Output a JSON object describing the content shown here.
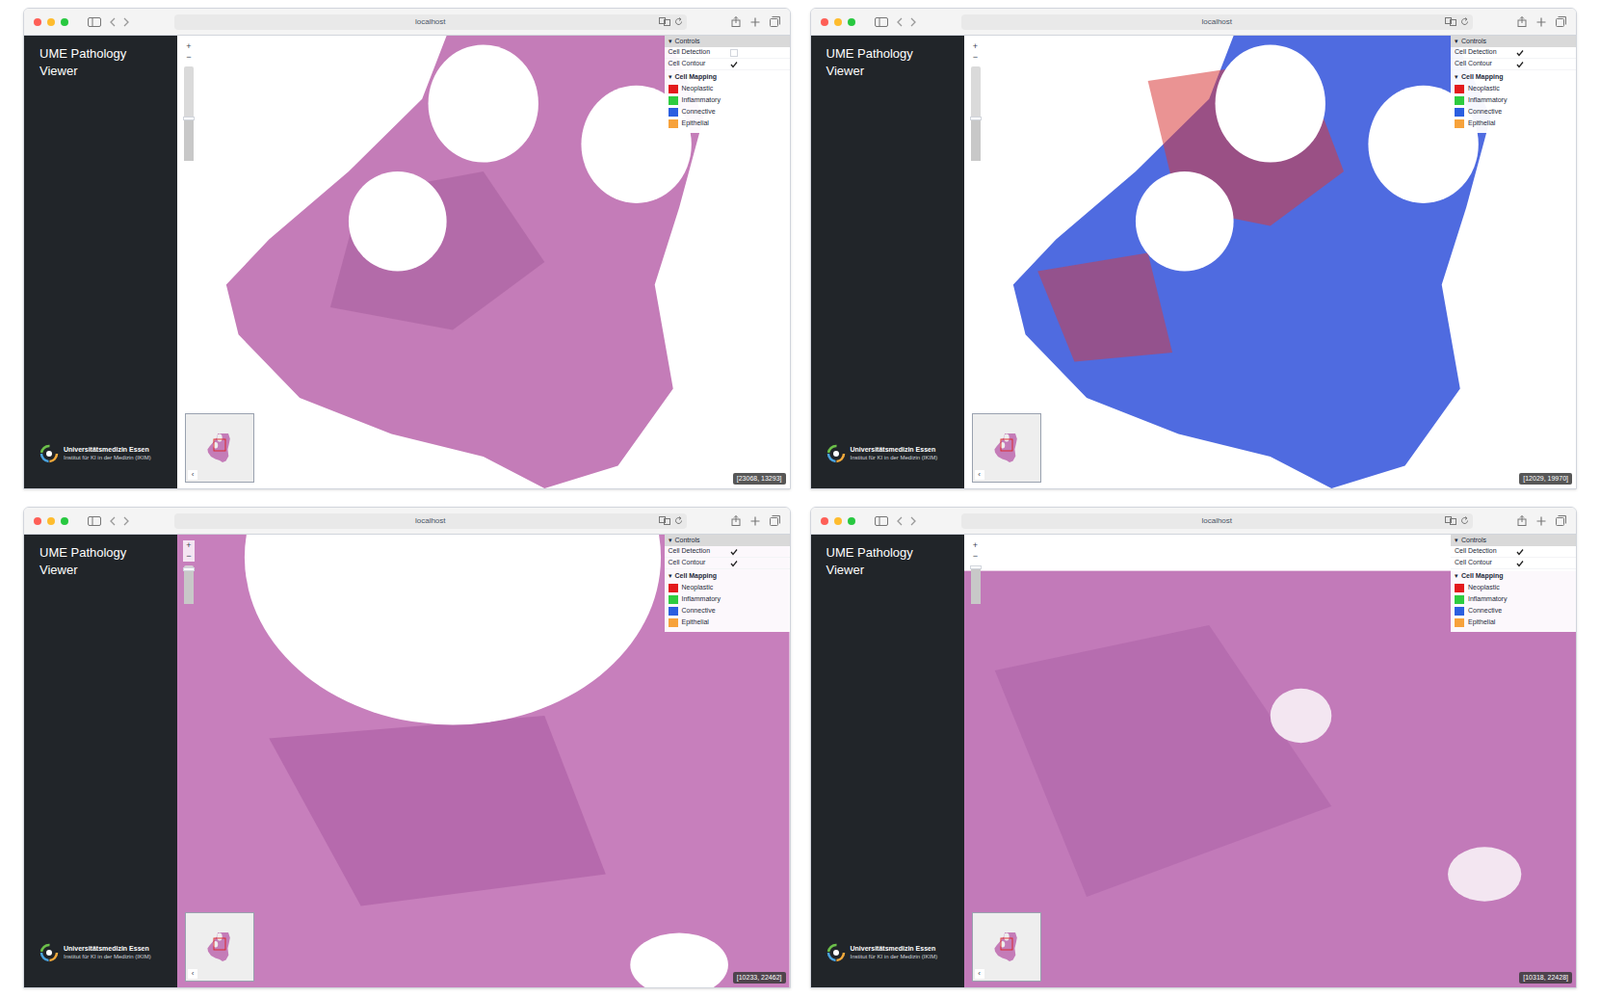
{
  "panels": [
    {
      "kind": "overview",
      "url": "localhost",
      "app_title": "UME Pathology Viewer",
      "zoom": {
        "in": "+",
        "out": "−"
      },
      "slider": {
        "level": 0.45
      },
      "controls": {
        "caret": "▾",
        "title": "Controls",
        "toggles": [
          {
            "label": "Cell Detection",
            "checked": false
          },
          {
            "label": "Cell Contour",
            "checked": true
          }
        ]
      },
      "legend": {
        "caret": "▾",
        "title": "Cell Mapping",
        "items": [
          {
            "label": "Neoplastic",
            "color": "#e31a1c"
          },
          {
            "label": "Inflammatory",
            "color": "#2ecc40"
          },
          {
            "label": "Connective",
            "color": "#2b5fe0"
          },
          {
            "label": "Epithelial",
            "color": "#f7a23b"
          }
        ]
      },
      "minimap_button": "‹",
      "coordinates": "[23068, 13293]",
      "footer": {
        "org": "Universitätsmedizin Essen",
        "institute": "Institut für KI in der Medizin (IKIM)"
      }
    },
    {
      "kind": "overlay",
      "url": "localhost",
      "app_title": "UME Pathology Viewer",
      "zoom": {
        "in": "+",
        "out": "−"
      },
      "slider": {
        "level": 0.45
      },
      "controls": {
        "caret": "▾",
        "title": "Controls",
        "toggles": [
          {
            "label": "Cell Detection",
            "checked": true
          },
          {
            "label": "Cell Contour",
            "checked": true
          }
        ]
      },
      "legend": {
        "caret": "▾",
        "title": "Cell Mapping",
        "items": [
          {
            "label": "Neoplastic",
            "color": "#e31a1c"
          },
          {
            "label": "Inflammatory",
            "color": "#2ecc40"
          },
          {
            "label": "Connective",
            "color": "#2b5fe0"
          },
          {
            "label": "Epithelial",
            "color": "#f7a23b"
          }
        ]
      },
      "minimap_button": "‹",
      "coordinates": "[12029, 19970]",
      "footer": {
        "org": "Universitätsmedizin Essen",
        "institute": "Institut für KI in der Medizin (IKIM)"
      }
    },
    {
      "kind": "zoomed",
      "url": "localhost",
      "app_title": "UME Pathology Viewer",
      "zoom": {
        "in": "+",
        "out": "−"
      },
      "slider": {
        "level": 0.9
      },
      "controls": {
        "caret": "▾",
        "title": "Controls",
        "toggles": [
          {
            "label": "Cell Detection",
            "checked": true
          },
          {
            "label": "Cell Contour",
            "checked": true
          }
        ]
      },
      "legend": {
        "caret": "▾",
        "title": "Cell Mapping",
        "items": [
          {
            "label": "Neoplastic",
            "color": "#e31a1c"
          },
          {
            "label": "Inflammatory",
            "color": "#2ecc40"
          },
          {
            "label": "Connective",
            "color": "#2b5fe0"
          },
          {
            "label": "Epithelial",
            "color": "#f7a23b"
          }
        ]
      },
      "minimap_button": "‹",
      "coordinates": "[10233, 22462]",
      "footer": {
        "org": "Universitätsmedizin Essen",
        "institute": "Institut für KI in der Medizin (IKIM)"
      }
    },
    {
      "kind": "detail",
      "url": "localhost",
      "app_title": "UME Pathology Viewer",
      "zoom": {
        "in": "+",
        "out": "−"
      },
      "slider": {
        "level": 0.95
      },
      "controls": {
        "caret": "▾",
        "title": "Controls",
        "toggles": [
          {
            "label": "Cell Detection",
            "checked": true
          },
          {
            "label": "Cell Contour",
            "checked": true
          }
        ]
      },
      "legend": {
        "caret": "▾",
        "title": "Cell Mapping",
        "items": [
          {
            "label": "Neoplastic",
            "color": "#e31a1c"
          },
          {
            "label": "Inflammatory",
            "color": "#2ecc40"
          },
          {
            "label": "Connective",
            "color": "#2b5fe0"
          },
          {
            "label": "Epithelial",
            "color": "#f7a23b"
          }
        ]
      },
      "minimap_button": "‹",
      "coordinates": "[10318, 22428]",
      "footer": {
        "org": "Universitätsmedizin Essen",
        "institute": "Institut für KI in der Medizin (IKIM)"
      }
    }
  ]
}
